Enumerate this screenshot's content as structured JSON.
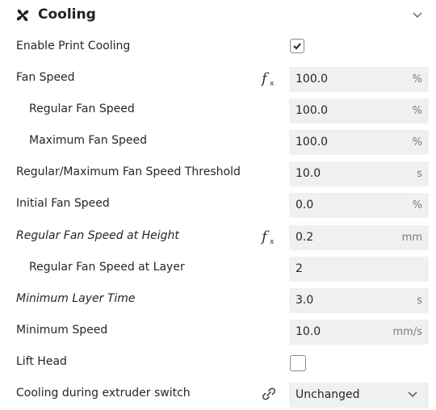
{
  "section": {
    "title": "Cooling",
    "icon": "fan-icon",
    "collapse_icon": "chevron-down-icon"
  },
  "settings": {
    "enable_print_cooling": {
      "label": "Enable Print Cooling",
      "checked": true
    },
    "fan_speed": {
      "label": "Fan Speed",
      "value": "100.0",
      "unit": "%"
    },
    "regular_fan_speed": {
      "label": "Regular Fan Speed",
      "value": "100.0",
      "unit": "%"
    },
    "maximum_fan_speed": {
      "label": "Maximum Fan Speed",
      "value": "100.0",
      "unit": "%"
    },
    "fan_speed_threshold": {
      "label": "Regular/Maximum Fan Speed Threshold",
      "value": "10.0",
      "unit": "s"
    },
    "initial_fan_speed": {
      "label": "Initial Fan Speed",
      "value": "0.0",
      "unit": "%"
    },
    "regular_fan_speed_height": {
      "label": "Regular Fan Speed at Height",
      "value": "0.2",
      "unit": "mm"
    },
    "regular_fan_speed_layer": {
      "label": "Regular Fan Speed at Layer",
      "value": "2",
      "unit": ""
    },
    "minimum_layer_time": {
      "label": "Minimum Layer Time",
      "value": "3.0",
      "unit": "s"
    },
    "minimum_speed": {
      "label": "Minimum Speed",
      "value": "10.0",
      "unit": "mm/s"
    },
    "lift_head": {
      "label": "Lift Head",
      "checked": false
    },
    "cooling_extruder_switch": {
      "label": "Cooling during extruder switch",
      "value": "Unchanged"
    }
  },
  "icons": {
    "function": "function-icon",
    "link": "link-icon",
    "checkmark": "checkmark-icon"
  },
  "colors": {
    "field_bg": "#f0f0f0",
    "text": "#262626",
    "unit_text": "#7a7a7a",
    "checkbox_border": "#8a8a8a"
  }
}
